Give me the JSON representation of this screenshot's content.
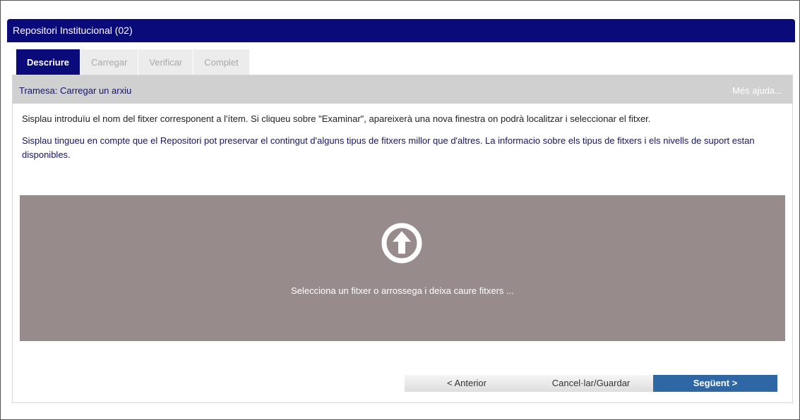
{
  "window": {
    "title": "Repositori Institucional (02)"
  },
  "tabs": [
    {
      "label": "Descriure",
      "active": true
    },
    {
      "label": "Carregar",
      "active": false
    },
    {
      "label": "Verificar",
      "active": false
    },
    {
      "label": "Complet",
      "active": false
    }
  ],
  "panel": {
    "title": "Tramesa: Carregar un arxiu",
    "help_link": "Més ajuda...",
    "instructions": "Sisplau introduïu el nom del fitxer corresponent a l'ítem. Si cliqueu sobre \"Examinar\", apareixerà una nova finestra on podrà localitzar i seleccionar el fitxer.",
    "notice": "Sisplau tingueu en compte que el Repositori pot preservar el contingut d'alguns tipus de fitxers millor que d'altres. La informacio sobre els tipus de fitxers i els nivells de suport estan disponibles."
  },
  "dropzone": {
    "icon": "upload-arrow-circle-icon",
    "text": "Selecciona un fitxer o arrossega i deixa caure fitxers ..."
  },
  "buttons": {
    "previous": "< Anterior",
    "cancel_save": "Cancel·lar/Guardar",
    "next": "Següent >"
  },
  "colors": {
    "brand": "#0a0a7a",
    "dropzone": "#978c8b",
    "next_button": "#2f67a5",
    "header_bar": "#d0d0d0"
  }
}
